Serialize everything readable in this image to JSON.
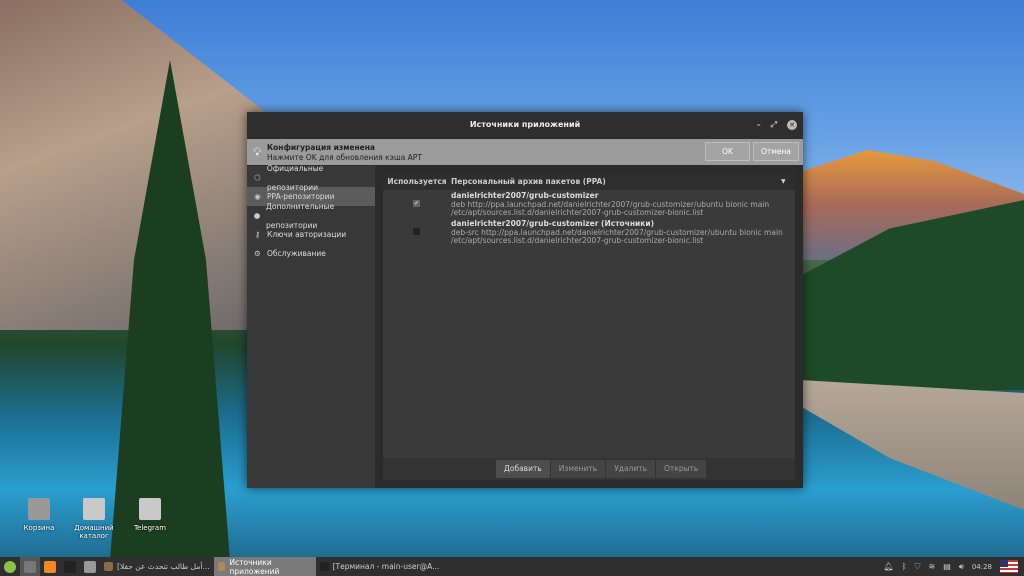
{
  "window": {
    "title": "Источники приложений"
  },
  "infobar": {
    "title": "Конфигурация изменена",
    "message": "Нажмите OK для обновления кэша APT",
    "ok": "OK",
    "cancel": "Отмена"
  },
  "sidebar": {
    "items": [
      {
        "label": "Официальные репозитории",
        "icon": "package-icon"
      },
      {
        "label": "PPA-репозитории",
        "icon": "ppa-icon",
        "selected": true
      },
      {
        "label": "Дополнительные репозитории",
        "icon": "globe-icon"
      },
      {
        "label": "Ключи авторизации",
        "icon": "key-icon"
      },
      {
        "label": "Обслуживание",
        "icon": "maintenance-icon"
      }
    ]
  },
  "table": {
    "col_used": "Используется",
    "col_ppa": "Персональный архив пакетов (PPA)",
    "rows": [
      {
        "checked": true,
        "name": "danielrichter2007/grub-customizer",
        "line1": "deb http://ppa.launchpad.net/danielrichter2007/grub-customizer/ubuntu bionic main",
        "line2": "/etc/apt/sources.list.d/danielrichter2007-grub-customizer-bionic.list"
      },
      {
        "checked": false,
        "name": "danielrichter2007/grub-customizer (Источники)",
        "line1": "deb-src http://ppa.launchpad.net/danielrichter2007/grub-customizer/ubuntu bionic main",
        "line2": "/etc/apt/sources.list.d/danielrichter2007-grub-customizer-bionic.list"
      }
    ]
  },
  "buttons": {
    "add": "Добавить",
    "edit": "Изменить",
    "remove": "Удалить",
    "open": "Открыть"
  },
  "desktop": {
    "icons": [
      "Корзина",
      "Домашний каталог",
      "Telegram"
    ]
  },
  "taskbar": {
    "items": [
      "[أمل طالب تتحدث عن حفلا...",
      "Источники приложений",
      "[Терминал - main-user@A..."
    ],
    "clock": "04:28"
  }
}
